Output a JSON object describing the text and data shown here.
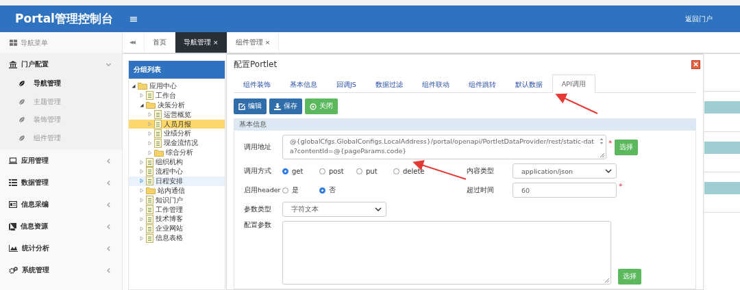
{
  "header": {
    "title": "Portal管理控制台",
    "menu_glyph": "≡",
    "right_link": "返回门户"
  },
  "sidebar": {
    "heading": "导航菜单",
    "groups": [
      {
        "label": "门户配置",
        "expanded": true,
        "children": [
          {
            "label": "导航管理",
            "selected": true
          },
          {
            "label": "主题管理",
            "selected": false
          },
          {
            "label": "装饰管理",
            "selected": false
          },
          {
            "label": "组件管理",
            "selected": false
          }
        ]
      },
      {
        "label": "应用管理",
        "expanded": false
      },
      {
        "label": "数据管理",
        "expanded": false
      },
      {
        "label": "信息采编",
        "expanded": false
      },
      {
        "label": "信息资源",
        "expanded": false
      },
      {
        "label": "统计分析",
        "expanded": false
      },
      {
        "label": "系统管理",
        "expanded": false
      }
    ]
  },
  "page_tabs": {
    "back_glyph": "◀◀",
    "home": "首页",
    "tabs": [
      {
        "label": "导航管理",
        "close": "×",
        "selected": true
      },
      {
        "label": "组件管理",
        "close": "×",
        "selected": false
      }
    ]
  },
  "tree_panel": {
    "title": "分组列表",
    "nodes": [
      {
        "label": "应用中心",
        "kind": "folder",
        "expanded": true,
        "selected": false,
        "hover": false,
        "children": [
          {
            "label": "工作台",
            "kind": "file",
            "expanded": false,
            "selected": false,
            "hover": false
          },
          {
            "label": "决策分析",
            "kind": "folder",
            "expanded": true,
            "selected": false,
            "hover": false,
            "children": [
              {
                "label": "运营概览",
                "kind": "file",
                "expanded": false,
                "selected": false,
                "hover": false
              },
              {
                "label": "人员月报",
                "kind": "file",
                "expanded": false,
                "selected": true,
                "hover": false
              },
              {
                "label": "业绩分析",
                "kind": "file",
                "expanded": false,
                "selected": false,
                "hover": false
              },
              {
                "label": "现金流情况",
                "kind": "file",
                "expanded": false,
                "selected": false,
                "hover": false
              },
              {
                "label": "综合分析",
                "kind": "folder",
                "expanded": false,
                "selected": false,
                "hover": false
              }
            ]
          },
          {
            "label": "组织机构",
            "kind": "file",
            "expanded": false,
            "selected": false,
            "hover": false
          },
          {
            "label": "流程中心",
            "kind": "file",
            "expanded": false,
            "selected": false,
            "hover": false
          },
          {
            "label": "日程安排",
            "kind": "file",
            "expanded": false,
            "selected": false,
            "hover": true
          },
          {
            "label": "站内通信",
            "kind": "folder",
            "expanded": false,
            "selected": false,
            "hover": false
          },
          {
            "label": "知识门户",
            "kind": "file",
            "expanded": false,
            "selected": false,
            "hover": false
          },
          {
            "label": "工作管理",
            "kind": "file",
            "expanded": false,
            "selected": false,
            "hover": false
          },
          {
            "label": "技术博客",
            "kind": "file",
            "expanded": false,
            "selected": false,
            "hover": false
          },
          {
            "label": "企业网站",
            "kind": "file",
            "expanded": false,
            "selected": false,
            "hover": false
          },
          {
            "label": "信息表格",
            "kind": "file",
            "expanded": false,
            "selected": false,
            "hover": false
          }
        ]
      }
    ]
  },
  "dialog": {
    "title": "配置Portlet",
    "tabs": [
      {
        "label": "组件装饰",
        "selected": false
      },
      {
        "label": "基本信息",
        "selected": false
      },
      {
        "label": "回调JS",
        "selected": false
      },
      {
        "label": "数据过滤",
        "selected": false
      },
      {
        "label": "组件联动",
        "selected": false
      },
      {
        "label": "组件跳转",
        "selected": false
      },
      {
        "label": "默认数据",
        "selected": false
      },
      {
        "label": "API调用",
        "selected": true
      }
    ],
    "buttons": [
      {
        "label": "编辑",
        "kind": "edit"
      },
      {
        "label": "保存",
        "kind": "save"
      },
      {
        "label": "关闭",
        "kind": "close"
      }
    ],
    "section_title": "基本信息",
    "address": {
      "label": "调用地址",
      "value": "@{globalCfgs.GlobalConfigs.LocalAddress}/portal/openapi/PortletDataProvider/rest/static-data?contentId=@{pageParams.code}",
      "required_mark": "*",
      "button": "选择"
    },
    "method": {
      "label": "调用方式",
      "options": [
        {
          "label": "get",
          "selected": true
        },
        {
          "label": "post",
          "selected": false
        },
        {
          "label": "put",
          "selected": false
        },
        {
          "label": "delete",
          "selected": false
        }
      ]
    },
    "content_type": {
      "label": "内容类型",
      "value": "application/json"
    },
    "use_header": {
      "label": "启用header",
      "options": [
        {
          "label": "是",
          "selected": false
        },
        {
          "label": "否",
          "selected": true
        }
      ]
    },
    "timeout": {
      "label": "超过时间",
      "value": "60",
      "required_mark": "*"
    },
    "param_type": {
      "label": "参数类型",
      "value": "字符文本"
    },
    "config_params": {
      "label": "配置参数",
      "button": "选择"
    }
  }
}
